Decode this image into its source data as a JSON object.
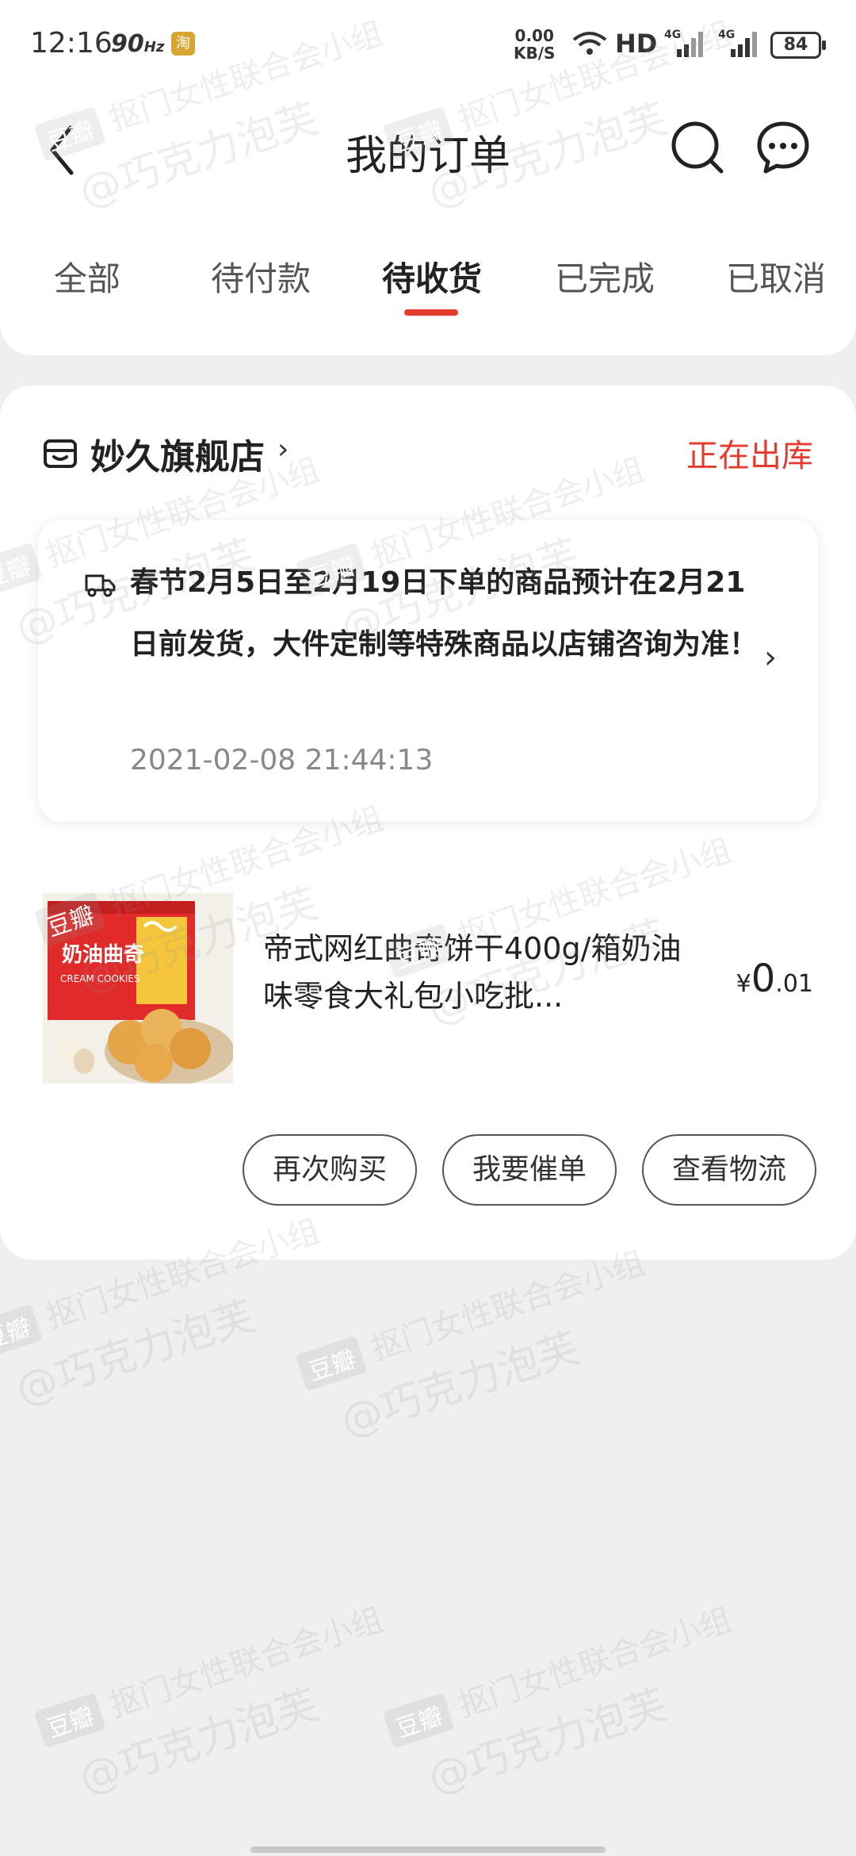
{
  "status_bar": {
    "time": "12:16",
    "refresh_rate": "90",
    "refresh_unit": "Hz",
    "app_badge": "淘",
    "net_speed_value": "0.00",
    "net_speed_unit": "KB/S",
    "hd_label": "HD",
    "battery": "84"
  },
  "header": {
    "title": "我的订单"
  },
  "tabs": [
    {
      "label": "全部"
    },
    {
      "label": "待付款"
    },
    {
      "label": "待收货"
    },
    {
      "label": "已完成"
    },
    {
      "label": "已取消"
    }
  ],
  "active_tab": "待收货",
  "order": {
    "store_name": "妙久旗舰店",
    "status": "正在出库",
    "notice": {
      "text": "春节2月5日至2月19日下单的商品预计在2月21日前发货，大件定制等特殊商品以店铺咨询为准！",
      "time": "2021-02-08 21:44:13"
    },
    "product": {
      "title": "帝式网红曲奇饼干400g/箱奶油味零食大礼包小吃批...",
      "image_label": "奶油曲奇",
      "image_sub": "CREAM COOKIES",
      "price_symbol": "¥",
      "price_int": "0",
      "price_dec": ".01"
    },
    "actions": [
      {
        "label": "再次购买"
      },
      {
        "label": "我要催单"
      },
      {
        "label": "查看物流"
      }
    ]
  },
  "watermark": {
    "logo": "豆瓣",
    "group": "抠门女性联合会小组",
    "user": "@巧克力泡芙"
  },
  "colors": {
    "accent": "#e43b2e",
    "background": "#efefef",
    "card": "#ffffff"
  }
}
